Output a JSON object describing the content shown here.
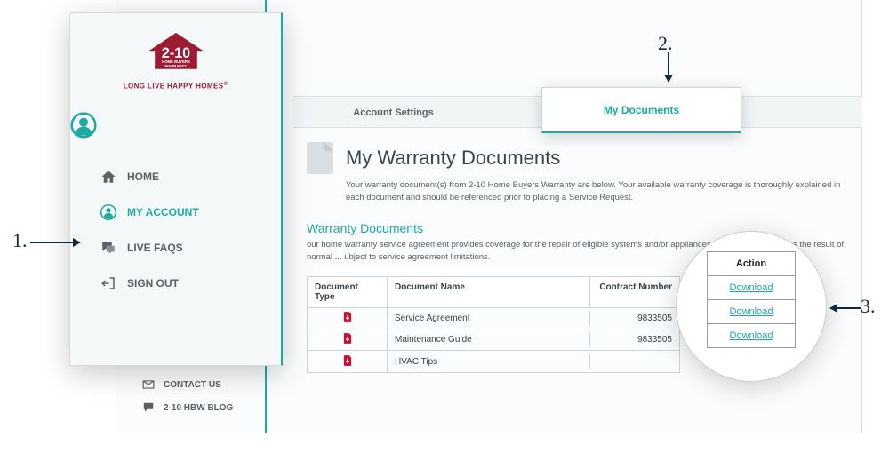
{
  "logo": {
    "tagline": "LONG LIVE HAPPY HOMES",
    "main": "2-10",
    "sub1": "HOME BUYERS",
    "sub2": "WARRANTY."
  },
  "sidebar": {
    "items": [
      {
        "label": "HOME"
      },
      {
        "label": "MY ACCOUNT"
      },
      {
        "label": "LIVE FAQS"
      },
      {
        "label": "SIGN OUT"
      }
    ],
    "lower": [
      {
        "label": "CONTACT US"
      },
      {
        "label": "2-10 HBW BLOG"
      }
    ]
  },
  "tabs": {
    "account": "Account Settings",
    "docs": "My Documents"
  },
  "page": {
    "title": "My Warranty Documents",
    "intro": "Your warranty document(s) from 2-10 Home Buyers Warranty are below. Your available warranty coverage is thoroughly explained in each document and should be referenced prior to placing a Service Request.",
    "section_title": "Warranty Documents",
    "section_desc": "our home warranty service agreement provides coverage for the repair of eligible systems and/or appliances when failures occur as the result of normal ... ubject to service agreement limitations."
  },
  "table": {
    "headers": {
      "type": "Document Type",
      "name": "Document Name",
      "contract": "Contract Number"
    },
    "rows": [
      {
        "name": "Service Agreement",
        "contract": "9833505"
      },
      {
        "name": "Maintenance Guide",
        "contract": "9833505"
      },
      {
        "name": "HVAC Tips",
        "contract": ""
      }
    ]
  },
  "action": {
    "header": "Action",
    "download": "Download"
  },
  "annotations": {
    "one": "1.",
    "two": "2.",
    "three": "3."
  }
}
